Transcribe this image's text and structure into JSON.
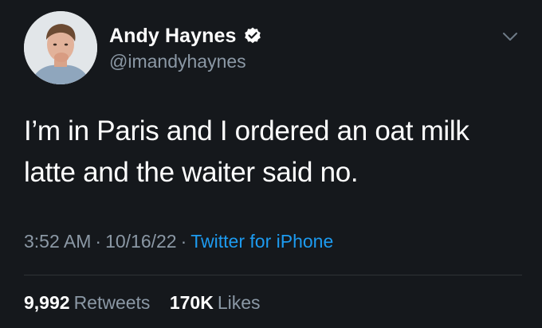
{
  "author": {
    "display_name": "Andy Haynes",
    "handle": "@imandyhaynes",
    "verified": true
  },
  "tweet": {
    "text": "I’m in Paris and I ordered an oat milk latte and the waiter said no."
  },
  "meta": {
    "time": "3:52 AM",
    "date": "10/16/22",
    "source": "Twitter for iPhone",
    "separator": "·"
  },
  "stats": {
    "retweets_count": "9,992",
    "retweets_label": "Retweets",
    "likes_count": "170K",
    "likes_label": "Likes"
  },
  "icons": {
    "verified": "verified-badge-icon",
    "more": "chevron-down-icon"
  },
  "colors": {
    "background": "#15181c",
    "secondary_text": "#8b98a5",
    "link": "#1d9bf0",
    "divider": "#2f3336"
  }
}
